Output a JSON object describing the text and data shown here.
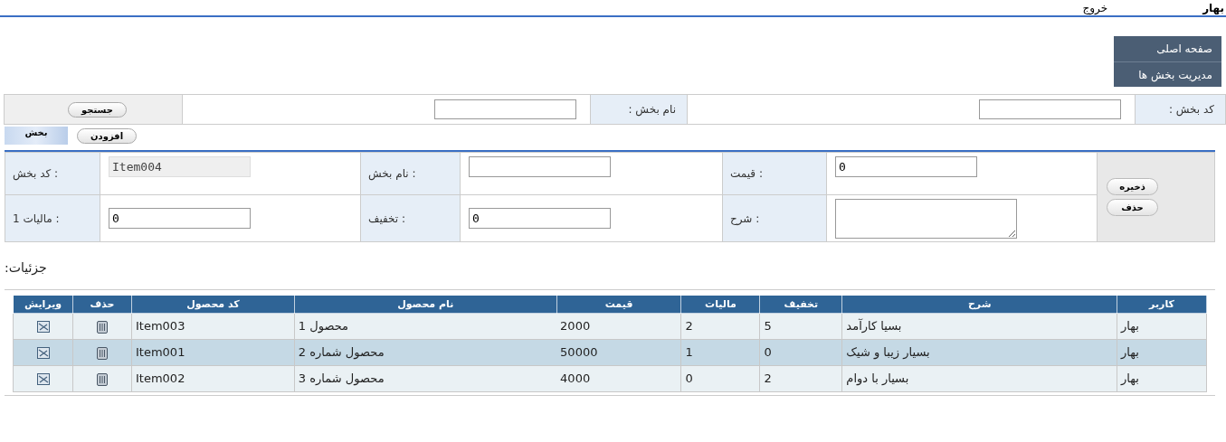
{
  "header": {
    "user": "بهار",
    "logout": "خروج"
  },
  "menu": [
    {
      "label": "صفحه اصلی"
    },
    {
      "label": "مدیریت بخش ها"
    }
  ],
  "search": {
    "fields": [
      {
        "label": "کد بخش :"
      },
      {
        "label": "نام بخش :"
      }
    ],
    "button": "جستجو"
  },
  "tabs": [
    {
      "label": "بخش"
    }
  ],
  "add_button": "افزودن",
  "form": {
    "rows": [
      [
        {
          "kind": "input",
          "value": "0",
          "disabled": false
        },
        {
          "kind": "label",
          "text": ": قیمت"
        },
        {
          "kind": "input",
          "disabled": false
        },
        {
          "kind": "label",
          "text": ": نام بخش"
        },
        {
          "kind": "input",
          "value": "Item004",
          "disabled": true
        },
        {
          "kind": "label",
          "text": ": کد بخش"
        }
      ],
      [
        {
          "kind": "textarea",
          "disabled": false
        },
        {
          "kind": "label",
          "text": ": شرح"
        },
        {
          "kind": "input",
          "value": "0",
          "disabled": false
        },
        {
          "kind": "label",
          "text": ": تخفیف"
        },
        {
          "kind": "input",
          "value": "0",
          "disabled": false
        },
        {
          "kind": "label",
          "text": ": مالیات 1"
        }
      ]
    ],
    "buttons": [
      "ذخیره",
      "حذف"
    ]
  },
  "details_title": "جزئیات:",
  "table": {
    "columns": [
      "کاربر",
      "شرح",
      "تخفیف",
      "مالیات",
      "قیمت",
      "نام محصول",
      "کد محصول",
      "حذف",
      "ویرایش"
    ],
    "rows": [
      {
        "user": "بهار",
        "description": "بسیا کارآمد",
        "discount": "5",
        "tax": "2",
        "price": "2000",
        "name": "محصول 1",
        "code": "Item003"
      },
      {
        "user": "بهار",
        "description": "بسیار زیبا و شیک",
        "discount": "0",
        "tax": "1",
        "price": "50000",
        "name": "محصول شماره 2",
        "code": "Item001"
      },
      {
        "user": "بهار",
        "description": "بسیار با دوام",
        "discount": "2",
        "tax": "0",
        "price": "4000",
        "name": "محصول شماره 3",
        "code": "Item002"
      }
    ]
  }
}
